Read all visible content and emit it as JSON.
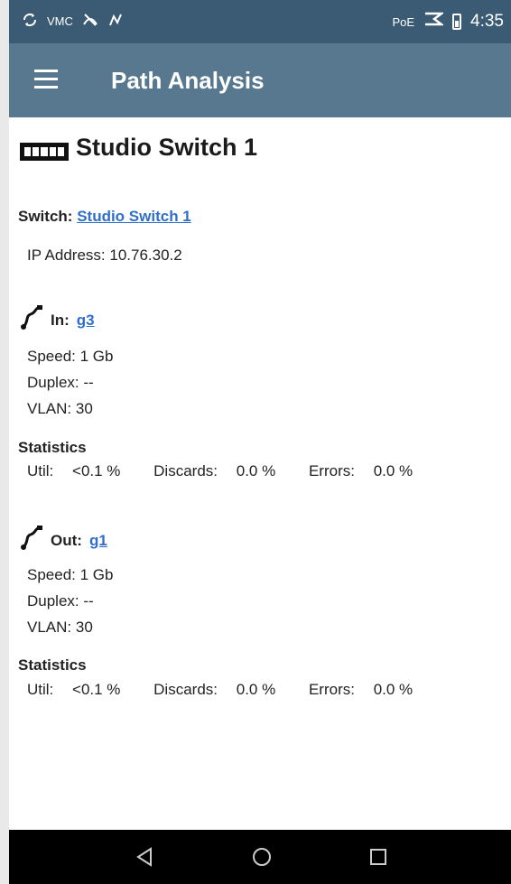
{
  "status_bar": {
    "left_icons": [
      "sync-icon",
      "vmc-text",
      "signal-off-icon",
      "link-icon"
    ],
    "vmc_label": "VMC",
    "poe_label": "PoE",
    "time": "4:35"
  },
  "app_bar": {
    "title": "Path Analysis"
  },
  "device": {
    "name": "Studio Switch 1",
    "switch_label": "Switch:",
    "switch_link": "Studio Switch 1",
    "ip_label": "IP Address:",
    "ip_value": "10.76.30.2"
  },
  "in_port": {
    "label": "In:",
    "port": "g3",
    "speed_label": "Speed:",
    "speed": "1 Gb",
    "duplex_label": "Duplex:",
    "duplex": "--",
    "vlan_label": "VLAN:",
    "vlan": "30",
    "stats_heading": "Statistics",
    "util_label": "Util:",
    "util": "<0.1 %",
    "discards_label": "Discards:",
    "discards": "0.0 %",
    "errors_label": "Errors:",
    "errors": "0.0 %"
  },
  "out_port": {
    "label": "Out:",
    "port": "g1",
    "speed_label": "Speed:",
    "speed": "1 Gb",
    "duplex_label": "Duplex:",
    "duplex": "--",
    "vlan_label": "VLAN:",
    "vlan": "30",
    "stats_heading": "Statistics",
    "util_label": "Util:",
    "util": "<0.1 %",
    "discards_label": "Discards:",
    "discards": "0.0 %",
    "errors_label": "Errors:",
    "errors": "0.0 %"
  },
  "colors": {
    "status_bar": "#3b5a73",
    "app_bar": "#57788f",
    "link": "#2f6fc9",
    "nav_bar": "#000000"
  },
  "nav": {
    "buttons": [
      "back-icon",
      "home-icon",
      "recents-icon"
    ]
  }
}
